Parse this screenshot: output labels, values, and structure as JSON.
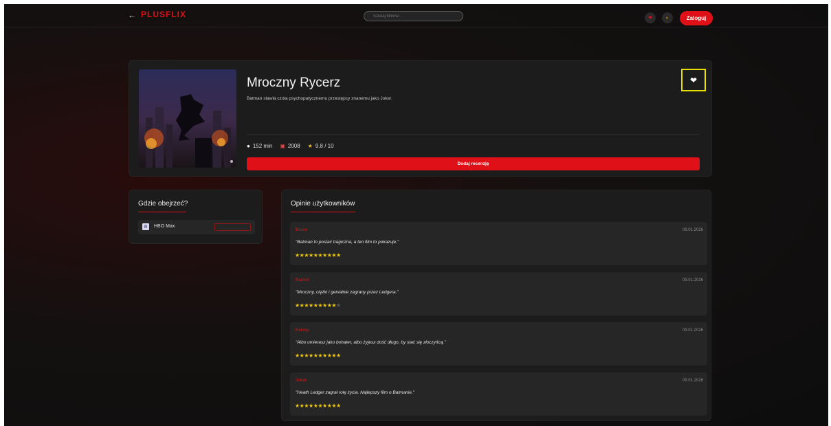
{
  "header": {
    "back_icon": "arrow-left-icon",
    "logo": "PLUSFLIX",
    "search_placeholder": "Szukaj filmów...",
    "favorites_icon": "heart-icon",
    "theme_icon": "theme-toggle-icon",
    "login_label": "Zaloguj"
  },
  "movie": {
    "title": "Mroczny Rycerz",
    "description": "Batman stawia czoła psychopatycznemu przestępcy znanemu jako Joker.",
    "duration": "152 min",
    "year": "2008",
    "rating": "9.8 / 10",
    "add_review_label": "Dodaj recenzję",
    "favorite_icon": "heart-icon"
  },
  "watch": {
    "heading": "Gdzie obejrzeć?",
    "providers": [
      {
        "name": "HBO Max"
      }
    ]
  },
  "reviews": {
    "heading": "Opinie użytkowników",
    "items": [
      {
        "author": "Bruce",
        "date": "09.01.2026",
        "text": "\"Batman to postać tragiczna, a ten film to pokazuje.\"",
        "stars": 10,
        "max": 10
      },
      {
        "author": "Rachel",
        "date": "09.01.2026",
        "text": "\"Mroczny, ciężki i genialnie zagrany przez Ledgera.\"",
        "stars": 9,
        "max": 10
      },
      {
        "author": "Harvey",
        "date": "09.01.2026",
        "text": "\"Albo umierasz jako bohater, albo żyjesz dość długo, by stać się złoczyńcą.\"",
        "stars": 10,
        "max": 10
      },
      {
        "author": "Joker",
        "date": "09.01.2026",
        "text": "\"Heath Ledger zagrał rolę życia. Najlepszy film o Batmanie.\"",
        "stars": 10,
        "max": 10
      }
    ]
  },
  "colors": {
    "accent": "#e01018",
    "star": "#f0c810",
    "highlight": "#e8e000"
  }
}
